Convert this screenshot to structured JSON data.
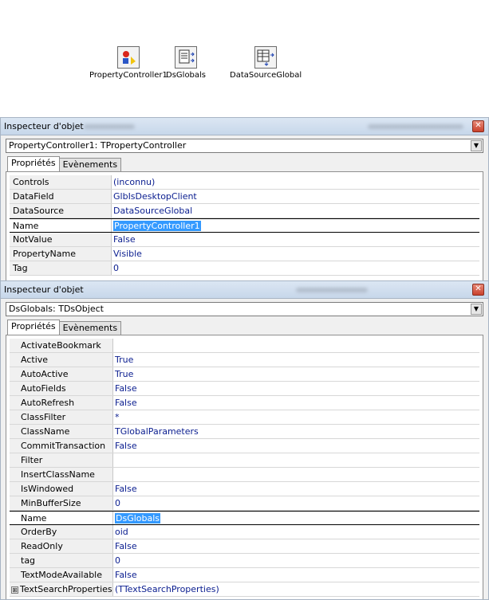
{
  "designer": {
    "components": [
      {
        "label": "PropertyController1",
        "icon": "property-controller-icon"
      },
      {
        "label": "DsGlobals",
        "icon": "dataset-icon"
      },
      {
        "label": "DataSourceGlobal",
        "icon": "datasource-icon"
      }
    ]
  },
  "inspector1": {
    "title": "Inspecteur d'objet",
    "selector": "PropertyController1: TPropertyController",
    "tabs": [
      "Propriétés",
      "Evènements"
    ],
    "rows": [
      {
        "name": "Controls",
        "value": "(inconnu)"
      },
      {
        "name": "DataField",
        "value": "GlbIsDesktopClient"
      },
      {
        "name": "DataSource",
        "value": "DataSourceGlobal"
      },
      {
        "name": "Name",
        "value": "PropertyController1"
      },
      {
        "name": "NotValue",
        "value": "False"
      },
      {
        "name": "PropertyName",
        "value": "Visible"
      },
      {
        "name": "Tag",
        "value": "0"
      }
    ]
  },
  "inspector2": {
    "title": "Inspecteur d'objet",
    "selector": "DsGlobals: TDsObject",
    "tabs": [
      "Propriétés",
      "Evènements"
    ],
    "rows": [
      {
        "name": "ActivateBookmark",
        "value": ""
      },
      {
        "name": "Active",
        "value": "True"
      },
      {
        "name": "AutoActive",
        "value": "True"
      },
      {
        "name": "AutoFields",
        "value": "False"
      },
      {
        "name": "AutoRefresh",
        "value": "False"
      },
      {
        "name": "ClassFilter",
        "value": "*"
      },
      {
        "name": "ClassName",
        "value": "TGlobalParameters"
      },
      {
        "name": "CommitTransaction",
        "value": "False"
      },
      {
        "name": "Filter",
        "value": ""
      },
      {
        "name": "InsertClassName",
        "value": ""
      },
      {
        "name": "IsWindowed",
        "value": "False"
      },
      {
        "name": "MinBufferSize",
        "value": "0"
      },
      {
        "name": "Name",
        "value": "DsGlobals"
      },
      {
        "name": "OrderBy",
        "value": "oid"
      },
      {
        "name": "ReadOnly",
        "value": "False"
      },
      {
        "name": "tag",
        "value": "0"
      },
      {
        "name": "TextModeAvailable",
        "value": "False"
      },
      {
        "name": "TextSearchProperties",
        "value": "(TTextSearchProperties)",
        "expand": "⊞"
      }
    ]
  },
  "colors": {
    "value_text": "#0a1d8f",
    "selection": "#3399ff",
    "titlebar": "#c7d7ea"
  }
}
